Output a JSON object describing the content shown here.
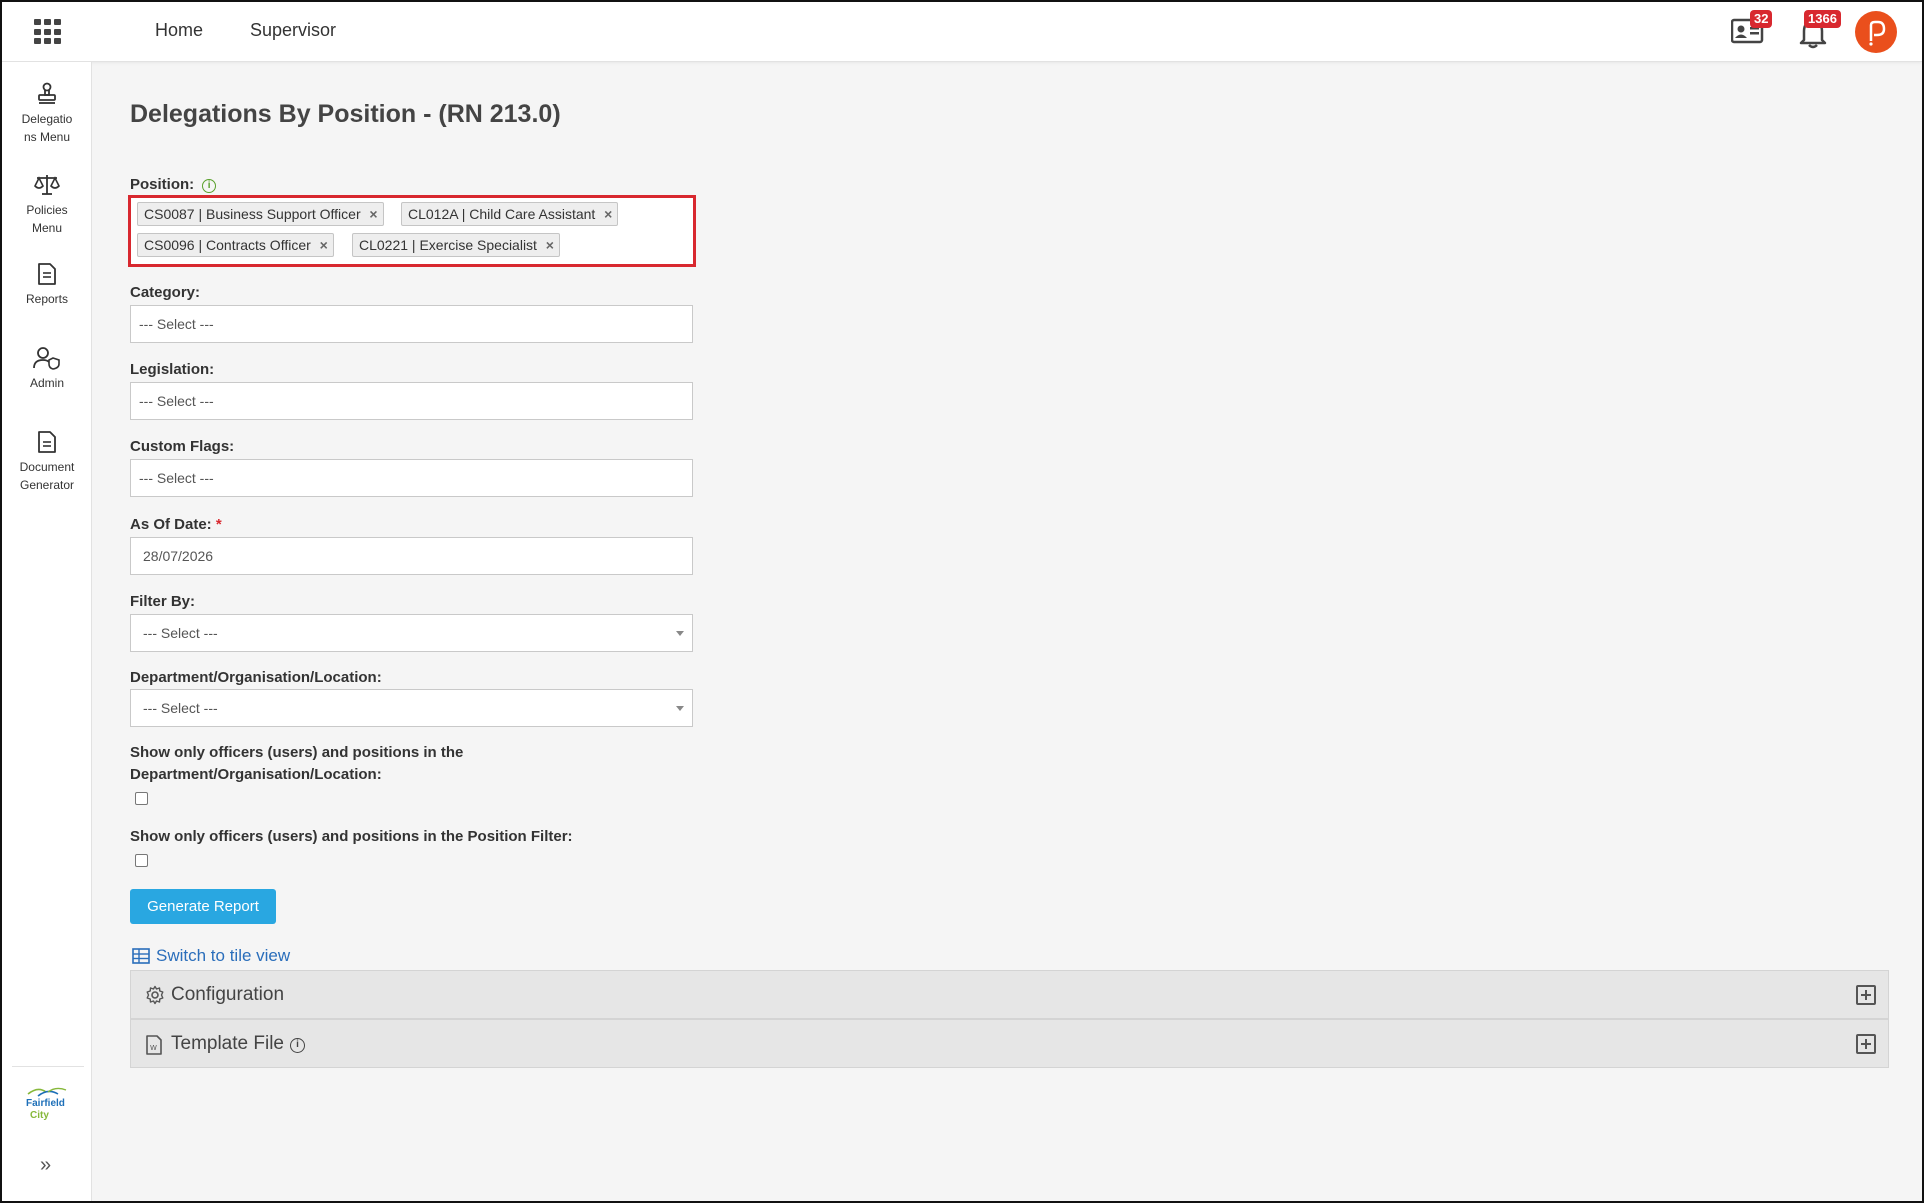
{
  "topbar": {
    "nav": [
      {
        "label": "Home"
      },
      {
        "label": "Supervisor"
      }
    ],
    "contacts_badge": "32",
    "notifications_badge": "1366"
  },
  "sidebar": {
    "items": [
      {
        "label": "Delegatio",
        "label2": "ns Menu",
        "icon": "stamp-icon"
      },
      {
        "label": "Policies",
        "label2": "Menu",
        "icon": "scales-icon"
      },
      {
        "label": "Reports",
        "label2": "",
        "icon": "report-icon"
      },
      {
        "label": "Admin",
        "label2": "",
        "icon": "admin-user-icon"
      },
      {
        "label": "Document",
        "label2": "Generator",
        "icon": "document-icon"
      }
    ],
    "logo_line1": "Fairfield",
    "logo_line2": "City"
  },
  "page": {
    "title": "Delegations By Position - (RN 213.0)"
  },
  "form": {
    "position_label": "Position:",
    "position_tags": [
      "CS0087 | Business Support Officer",
      "CL012A | Child Care Assistant",
      "CS0096 | Contracts Officer",
      "CL0221 | Exercise Specialist"
    ],
    "category_label": "Category:",
    "category_value": "--- Select ---",
    "legislation_label": "Legislation:",
    "legislation_value": "--- Select ---",
    "custom_flags_label": "Custom Flags:",
    "custom_flags_value": "--- Select ---",
    "as_of_date_label": "As Of Date:",
    "as_of_date_value": "28/07/2026",
    "filter_by_label": "Filter By:",
    "filter_by_value": "--- Select ---",
    "department_label": "Department/Organisation/Location:",
    "department_value": "--- Select ---",
    "show_dept_label_1": "Show only officers (users) and positions in the",
    "show_dept_label_2": "Department/Organisation/Location:",
    "show_dept_checked": false,
    "show_position_label": "Show only officers (users) and positions in the Position Filter:",
    "show_position_checked": false,
    "generate_button": "Generate Report",
    "tile_view_link": "Switch to tile view"
  },
  "panels": [
    {
      "label": "Configuration",
      "icon": "gear-icon"
    },
    {
      "label": "Template File",
      "icon": "word-file-icon"
    }
  ],
  "colors": {
    "accent": "#29a7e1",
    "highlight_border": "#d8282f",
    "badge": "#d8282f",
    "avatar": "#ea4f1c",
    "link": "#2a6ebb"
  }
}
